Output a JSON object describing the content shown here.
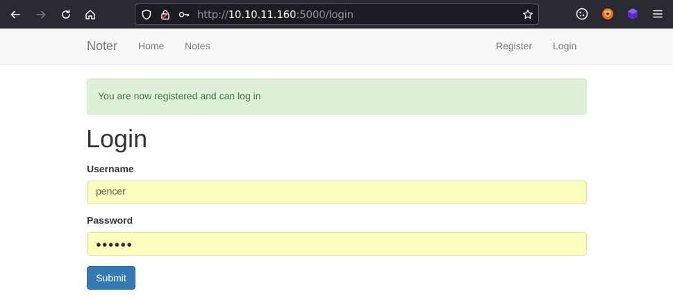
{
  "browser": {
    "url_prefix": "http://",
    "url_host": "10.10.11.160",
    "url_rest": ":5000/login"
  },
  "navbar": {
    "brand": "Noter",
    "links": [
      "Home",
      "Notes"
    ],
    "right_links": [
      "Register",
      "Login"
    ]
  },
  "alert": {
    "message": "You are now registered and can log in"
  },
  "form": {
    "title": "Login",
    "username_label": "Username",
    "username_value": "pencer",
    "password_label": "Password",
    "password_mask": "●●●●●●",
    "submit_label": "Submit"
  },
  "colors": {
    "alert_bg": "#dff0d8",
    "alert_text": "#3c763d",
    "autofill_bg": "#faffbd",
    "primary": "#337ab7"
  },
  "icons": [
    "back-icon",
    "forward-icon",
    "reload-icon",
    "home-icon",
    "shield-icon",
    "lock-icon",
    "key-icon",
    "star-icon",
    "cookie-icon",
    "fox-extension-icon",
    "cube-extension-icon",
    "menu-icon"
  ]
}
